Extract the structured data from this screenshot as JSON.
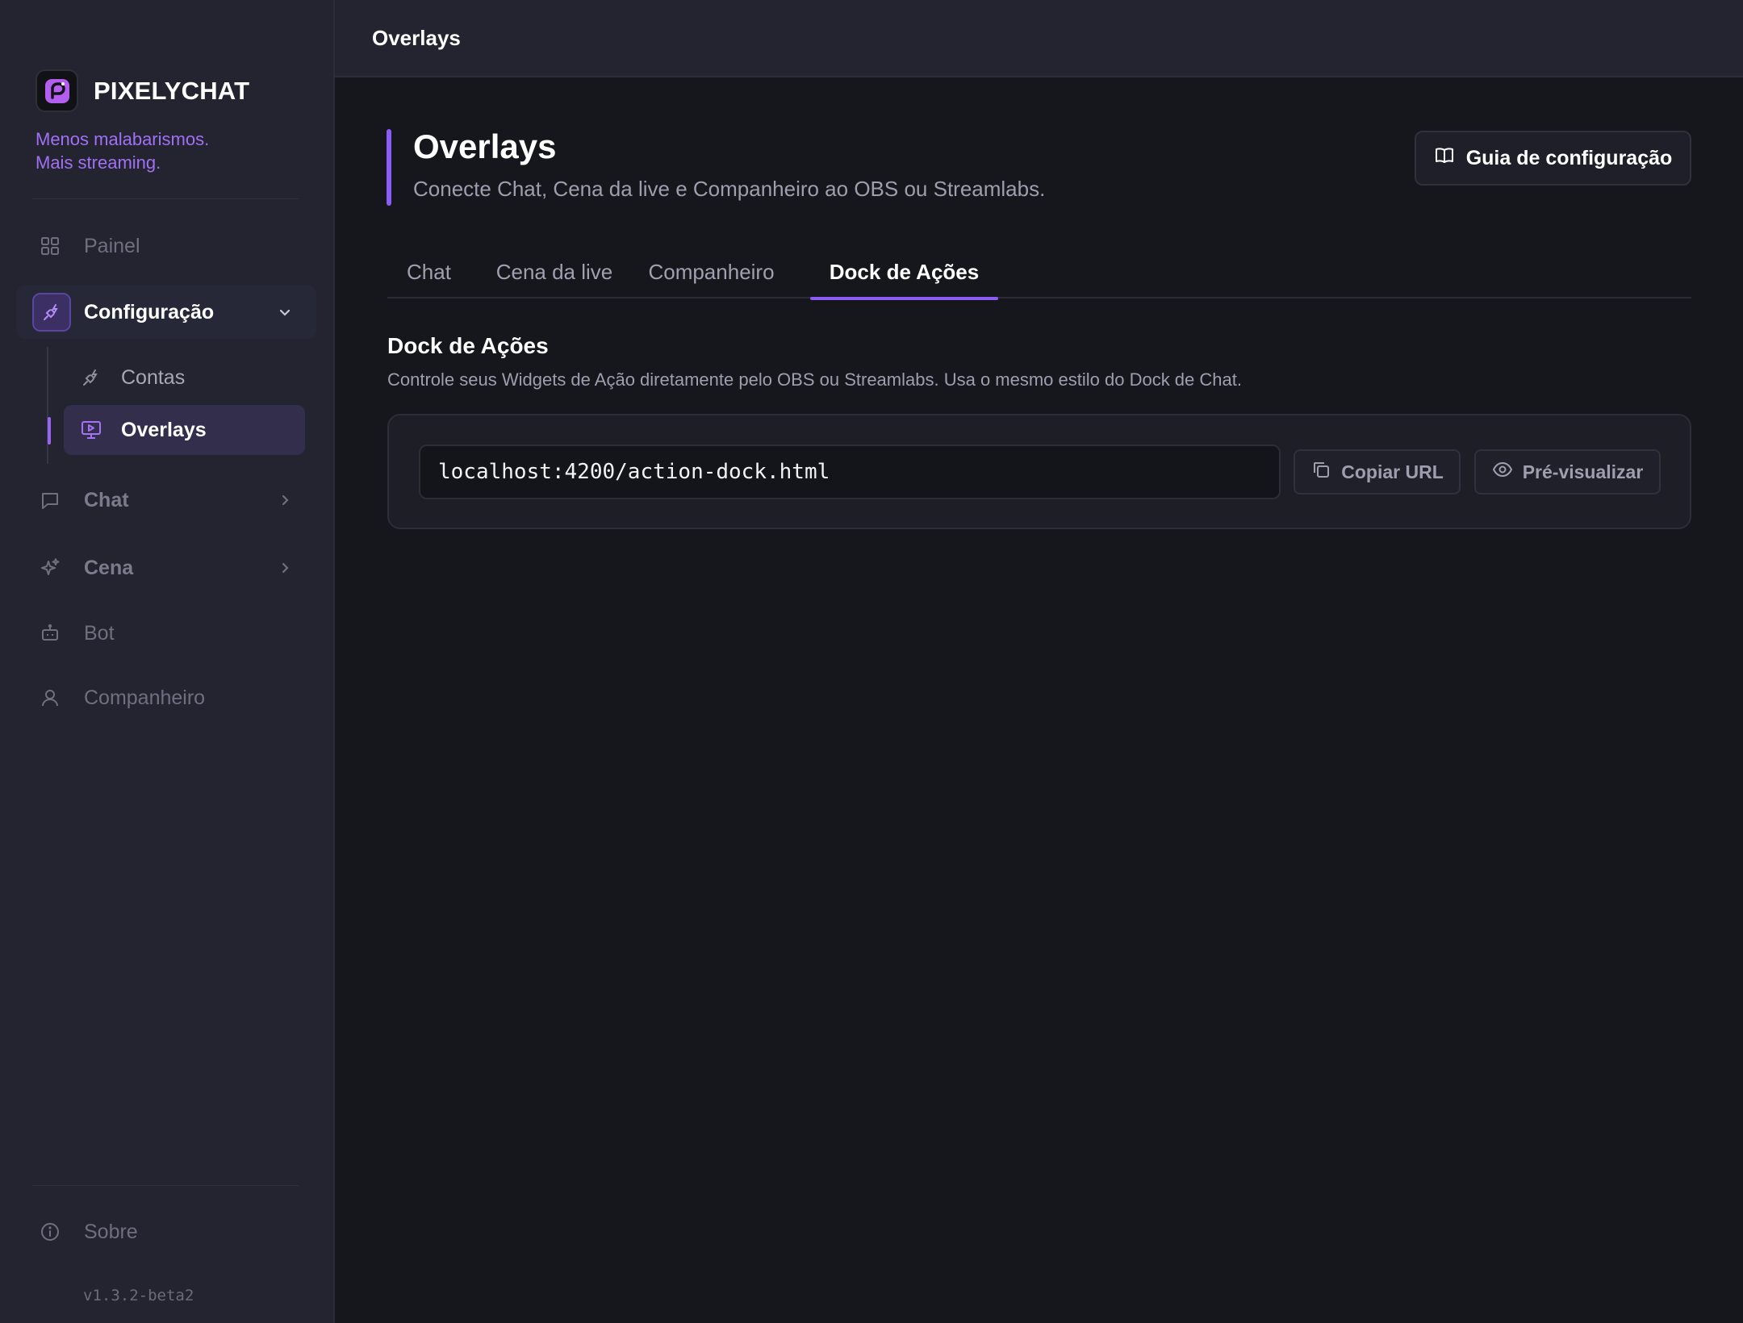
{
  "app": {
    "name": "PIXELYCHAT",
    "tagline_line1": "Menos malabarismos.",
    "tagline_line2": "Mais streaming.",
    "version": "v1.3.2-beta2"
  },
  "sidebar": {
    "painel": "Painel",
    "configuracao": "Configuração",
    "contas": "Contas",
    "overlays": "Overlays",
    "chat": "Chat",
    "cena": "Cena",
    "bot": "Bot",
    "companheiro": "Companheiro",
    "sobre": "Sobre"
  },
  "topbar": {
    "title": "Overlays"
  },
  "page": {
    "title": "Overlays",
    "subtitle": "Conecte Chat, Cena da live e Companheiro ao OBS ou Streamlabs.",
    "guide_button": "Guia de configuração"
  },
  "tabs": [
    {
      "label": "Chat",
      "active": false
    },
    {
      "label": "Cena da live",
      "active": false
    },
    {
      "label": "Companheiro",
      "active": false
    },
    {
      "label": "Dock de Ações",
      "active": true
    }
  ],
  "section": {
    "title": "Dock de Ações",
    "description": "Controle seus Widgets de Ação diretamente pelo OBS ou Streamlabs. Usa o mesmo estilo do Dock de Chat.",
    "url": "localhost:4200/action-dock.html",
    "copy_button": "Copiar URL",
    "preview_button": "Pré-visualizar"
  },
  "colors": {
    "accent": "#8b5cf6",
    "tagline": "#a170f5",
    "sidebar_bg": "#23242f",
    "main_bg": "#16171c"
  }
}
